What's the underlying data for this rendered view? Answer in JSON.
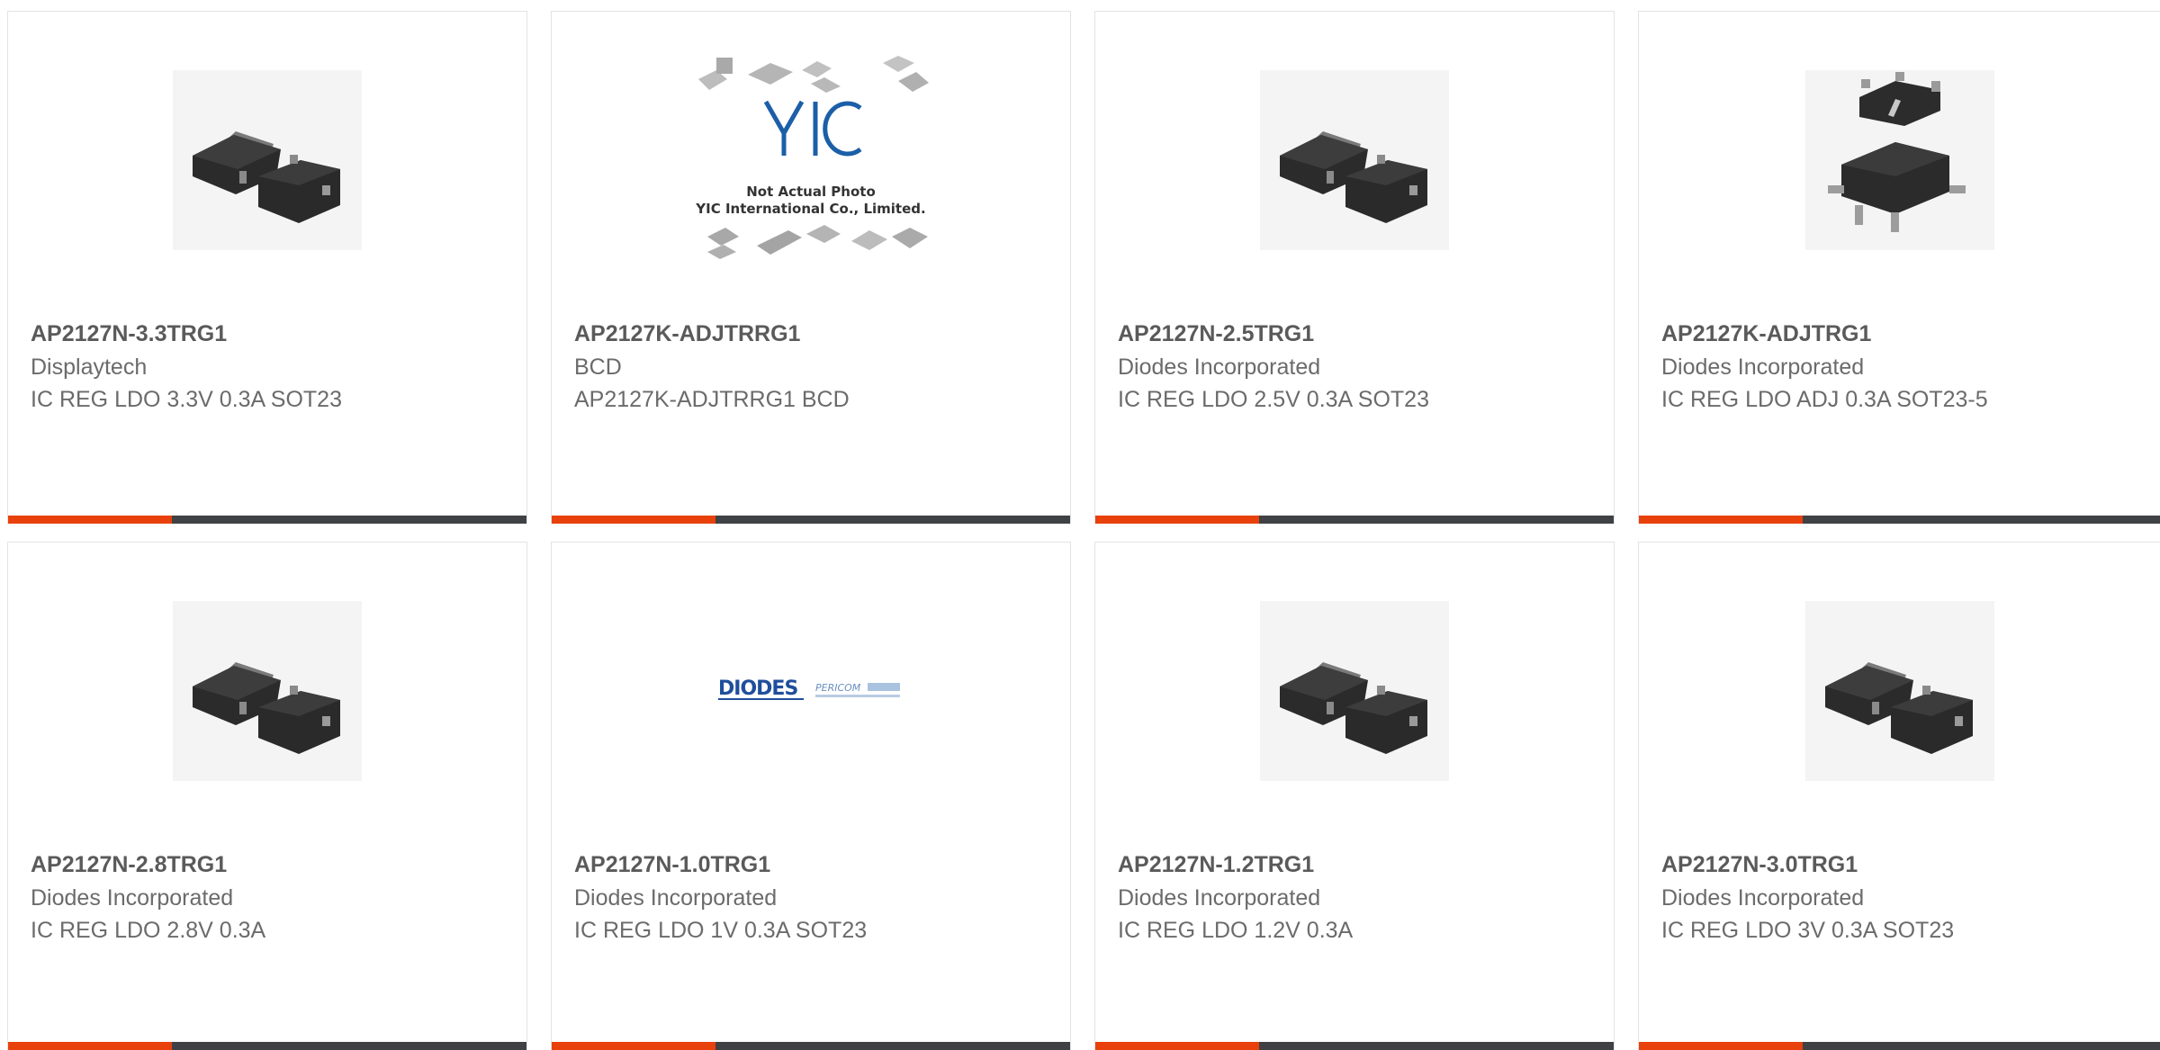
{
  "colors": {
    "accent": "#e8410c",
    "bar": "#3f4144",
    "text": "#5a5a5a"
  },
  "products": [
    {
      "part": "AP2127N-3.3TRG1",
      "manufacturer": "Displaytech",
      "description": "IC REG LDO 3.3V 0.3A SOT23",
      "image": "sot23-3-package-icon"
    },
    {
      "part": "AP2127K-ADJTRRG1",
      "manufacturer": "BCD",
      "description": "AP2127K-ADJTRRG1 BCD",
      "image": "yic-placeholder-image",
      "image_text": [
        "Not Actual Photo",
        "YIC International Co., Limited."
      ],
      "logo_text": "YIC"
    },
    {
      "part": "AP2127N-2.5TRG1",
      "manufacturer": "Diodes Incorporated",
      "description": "IC REG LDO 2.5V 0.3A SOT23",
      "image": "sot23-3-package-icon"
    },
    {
      "part": "AP2127K-ADJTRG1",
      "manufacturer": "Diodes Incorporated",
      "description": "IC REG LDO ADJ 0.3A SOT23-5",
      "image": "sot23-5-package-icon"
    },
    {
      "part": "AP2127N-2.8TRG1",
      "manufacturer": "Diodes Incorporated",
      "description": "IC REG LDO 2.8V 0.3A",
      "image": "sot23-3-package-icon"
    },
    {
      "part": "AP2127N-1.0TRG1",
      "manufacturer": "Diodes Incorporated",
      "description": "IC REG LDO 1V 0.3A SOT23",
      "image": "diodes-pericom-logo",
      "logo_text": [
        "DIODES",
        "PERICOM"
      ]
    },
    {
      "part": "AP2127N-1.2TRG1",
      "manufacturer": "Diodes Incorporated",
      "description": "IC REG LDO 1.2V 0.3A",
      "image": "sot23-3-package-icon"
    },
    {
      "part": "AP2127N-3.0TRG1",
      "manufacturer": "Diodes Incorporated",
      "description": "IC REG LDO 3V 0.3A SOT23",
      "image": "sot23-3-package-icon"
    }
  ]
}
